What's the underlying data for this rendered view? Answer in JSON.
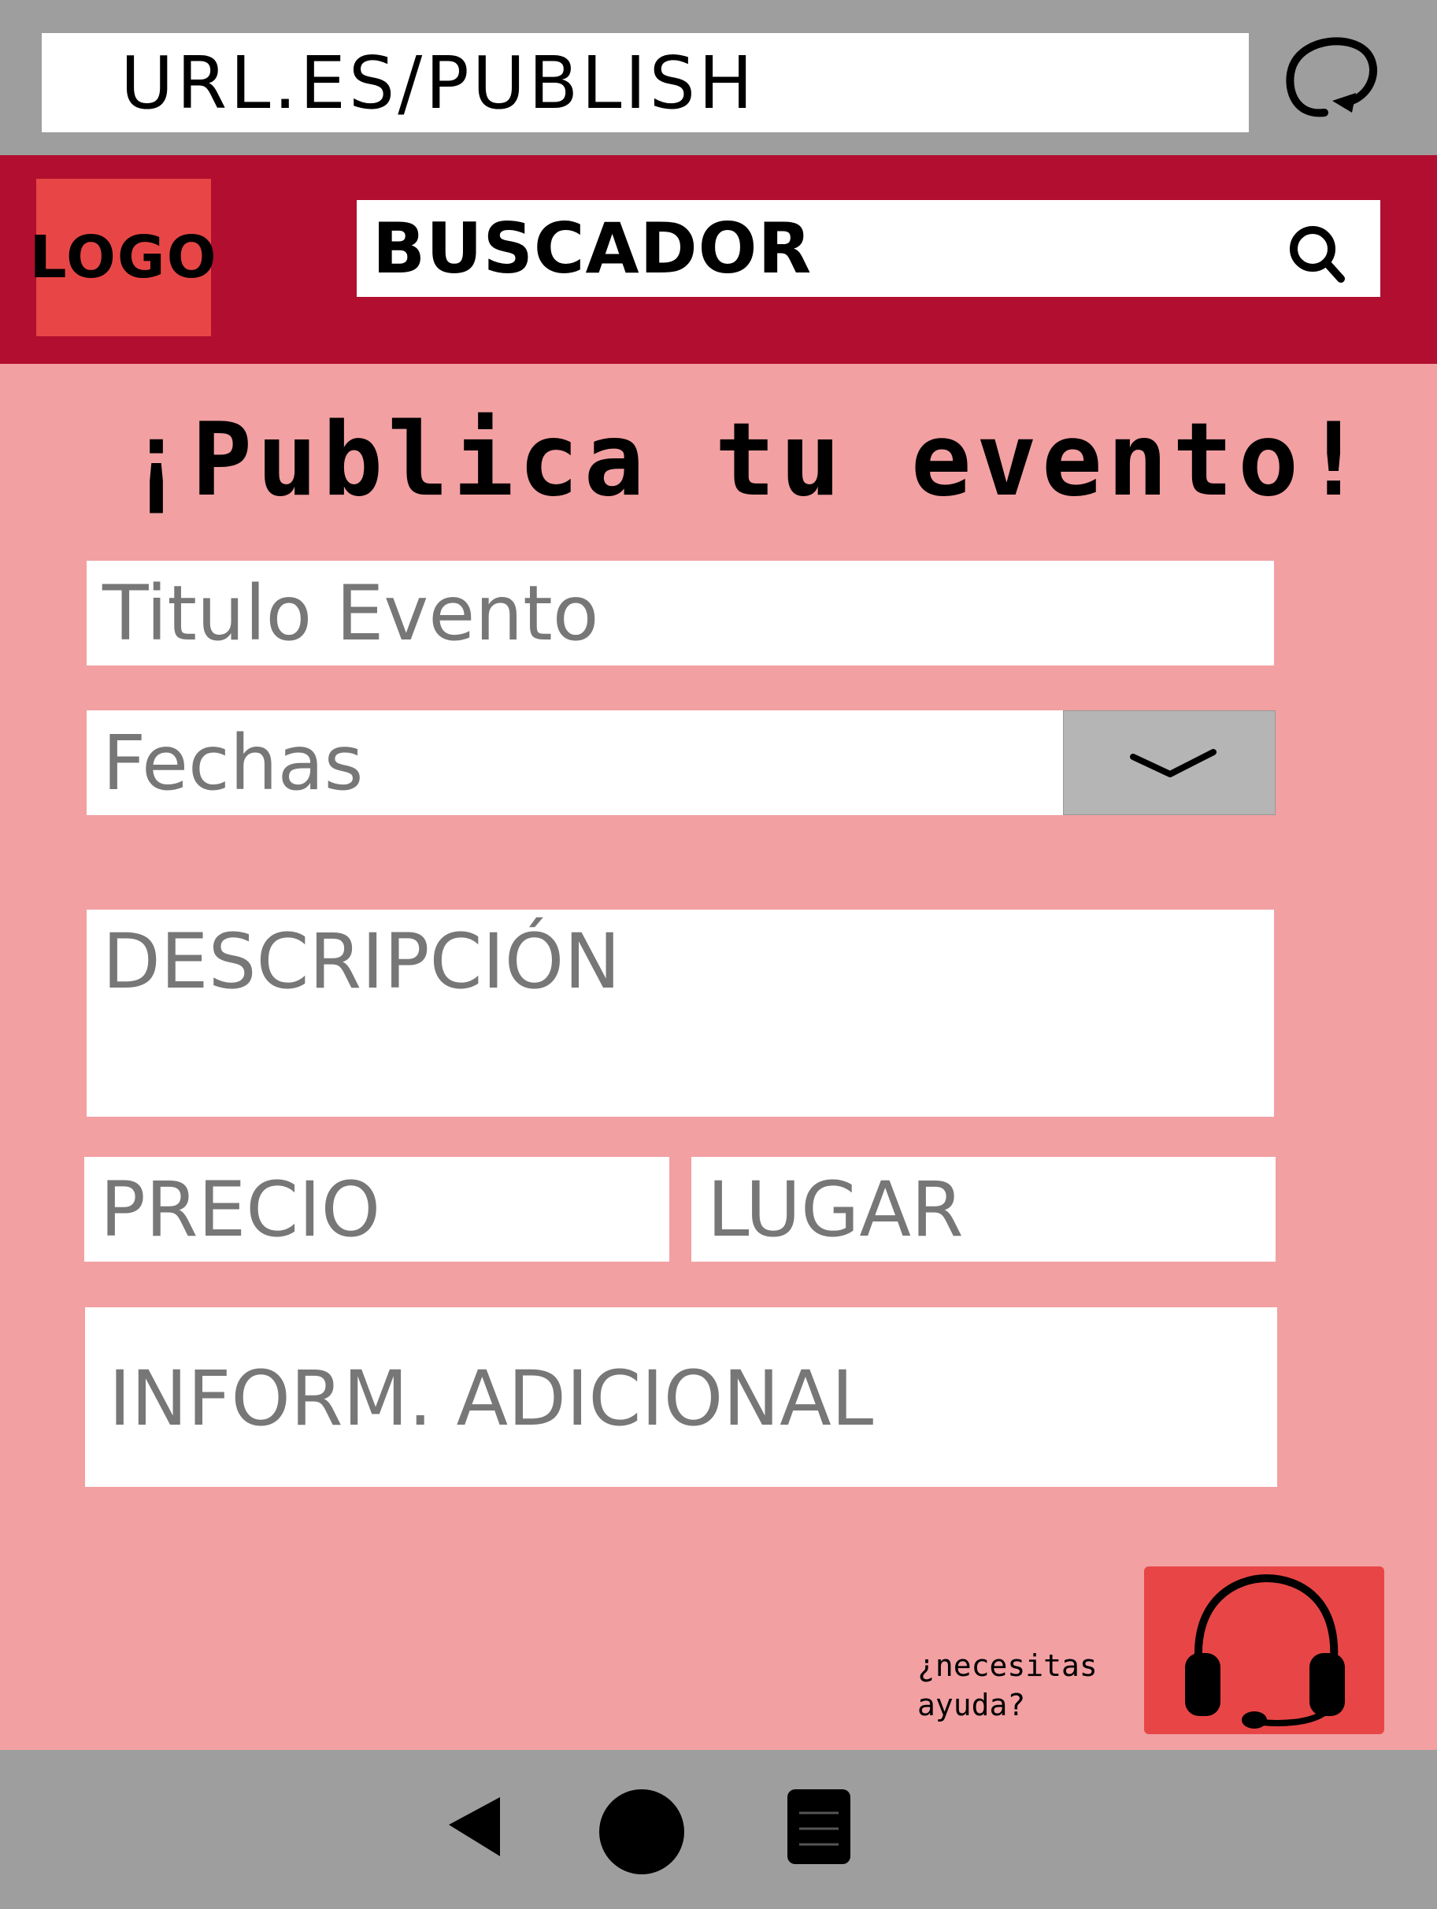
{
  "browser": {
    "url": "URL.ES/PUBLISH"
  },
  "header": {
    "logo_text": "LOGO",
    "search_placeholder": "BUSCADOR"
  },
  "form": {
    "title": "¡Publica tu evento!",
    "fields": {
      "event_title": "Titulo Evento",
      "dates": "Fechas",
      "description": "DESCRIPCIÓN",
      "price": "PRECIO",
      "place": "LUGAR",
      "additional_info": "INFORM. ADICIONAL"
    }
  },
  "help": {
    "line1": "¿necesitas",
    "line2": "ayuda?"
  },
  "colors": {
    "header": "#b20e2f",
    "accent": "#e84646",
    "background": "#f2a0a2",
    "chrome": "#9e9e9e"
  },
  "icons": {
    "refresh": "refresh-icon",
    "search": "search-icon",
    "dropdown": "chevron-down-icon",
    "help": "headset-icon",
    "back": "back-icon",
    "home": "home-icon",
    "menu": "menu-icon"
  }
}
